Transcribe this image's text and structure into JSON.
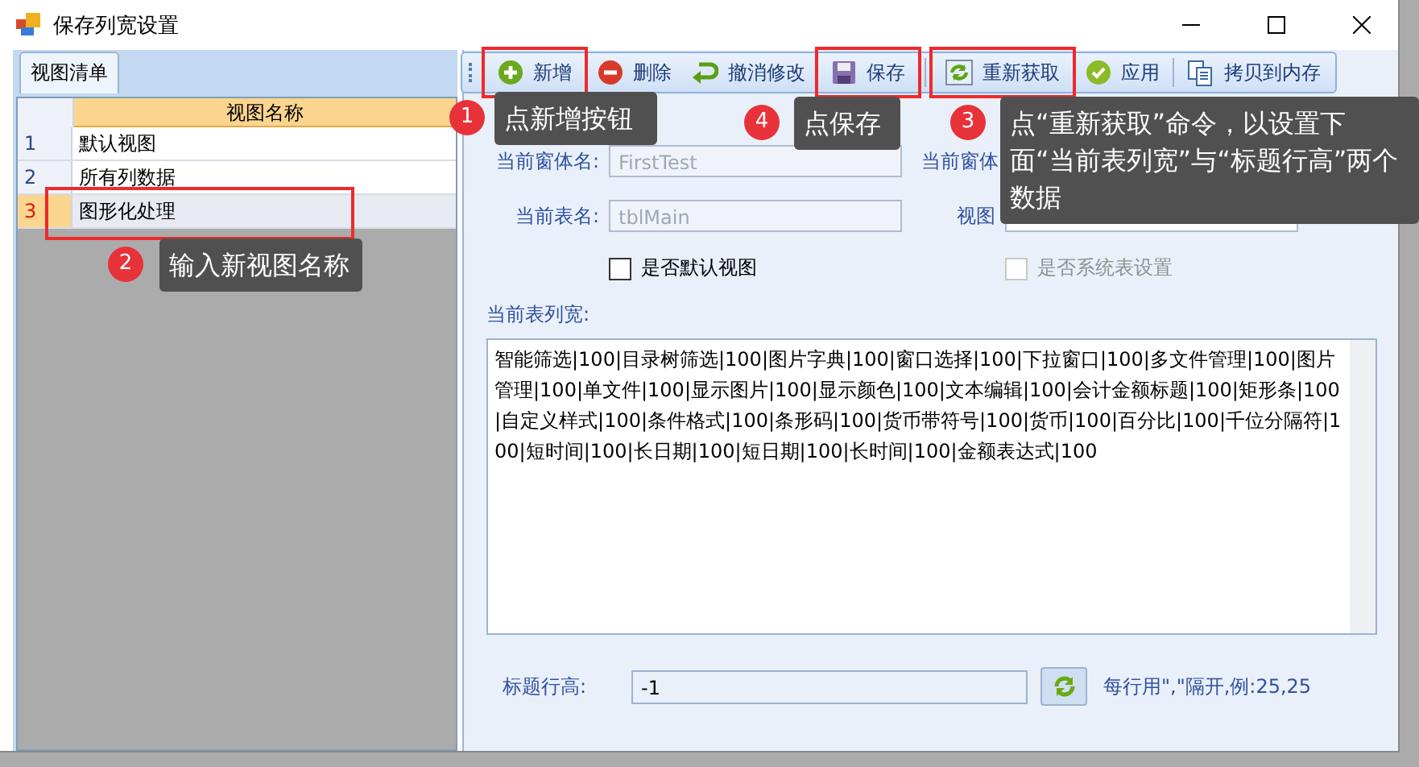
{
  "window": {
    "title": "保存列宽设置"
  },
  "left_tab": {
    "label": "视图清单",
    "selected": true
  },
  "grid": {
    "column": "视图名称",
    "rows": [
      {
        "index": "1",
        "name": "默认视图",
        "selected": false
      },
      {
        "index": "2",
        "name": "所有列数据",
        "selected": false
      },
      {
        "index": "3",
        "name": "图形化处理",
        "selected": true
      }
    ]
  },
  "toolbar": [
    {
      "label": "新增",
      "kind": "add",
      "separator_before": false
    },
    {
      "label": "删除",
      "kind": "remove",
      "separator_before": false
    },
    {
      "label": "撤消修改",
      "kind": "undo",
      "separator_before": false
    },
    {
      "label": "保存",
      "kind": "save",
      "separator_before": false
    },
    {
      "label": "重新获取",
      "kind": "refresh",
      "separator_before": true
    },
    {
      "label": "应用",
      "kind": "apply",
      "separator_before": false
    },
    {
      "label": "拷贝到内存",
      "kind": "copy",
      "separator_before": true
    }
  ],
  "form": {
    "form_name_label": "当前窗体名:",
    "form_name_value": "FirstTest",
    "table_label": "当前表名:",
    "table_value": "tblMain",
    "form_title_label": "当前窗体",
    "view_name_label": "视图",
    "default_view": {
      "label": "是否默认视图",
      "checked": false,
      "disabled": false
    },
    "system_table": {
      "label": "是否系统表设置",
      "checked": false,
      "disabled": true
    },
    "widths_label": "当前表列宽:",
    "widths_value": "智能筛选|100|目录树筛选|100|图片字典|100|窗口选择|100|下拉窗口|100|多文件管理|100|图片管理|100|单文件|100|显示图片|100|显示颜色|100|文本编辑|100|会计金额标题|100|矩形条|100|自定义样式|100|条件格式|100|条形码|100|货币带符号|100|货币|100|百分比|100|千位分隔符|100|短时间|100|长日期|100|短日期|100|长时间|100|金额表达式|100",
    "header_height_label": "标题行高:",
    "header_height_value": "-1",
    "hint": "每行用\",\"隔开,例:25,25"
  },
  "callouts": [
    {
      "number": "1",
      "text": "点新增按钮"
    },
    {
      "number": "2",
      "text": "输入新视图名称"
    },
    {
      "number": "4",
      "text": "点保存"
    },
    {
      "number": "3",
      "text": "点“重新获取”命令，以设置下面“当前表列宽”与“标题行高”两个数据"
    }
  ]
}
